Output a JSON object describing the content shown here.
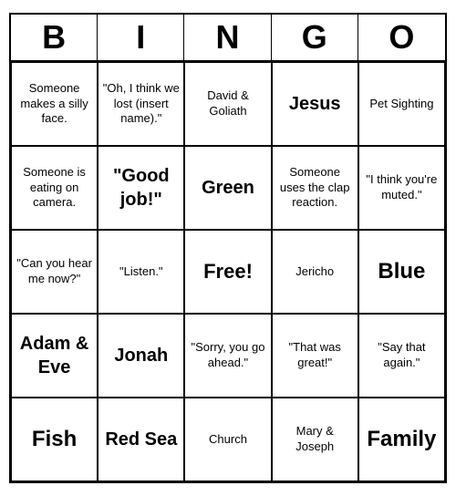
{
  "header": {
    "letters": [
      "B",
      "I",
      "N",
      "G",
      "O"
    ]
  },
  "cells": [
    {
      "text": "Someone makes a silly face.",
      "size": "normal"
    },
    {
      "text": "\"Oh, I think we lost (insert name).\"",
      "size": "normal"
    },
    {
      "text": "David & Goliath",
      "size": "normal"
    },
    {
      "text": "Jesus",
      "size": "large"
    },
    {
      "text": "Pet Sighting",
      "size": "normal"
    },
    {
      "text": "Someone is eating on camera.",
      "size": "normal"
    },
    {
      "text": "\"Good job!\"",
      "size": "large"
    },
    {
      "text": "Green",
      "size": "large"
    },
    {
      "text": "Someone uses the clap reaction.",
      "size": "normal"
    },
    {
      "text": "\"I think you're muted.\"",
      "size": "normal"
    },
    {
      "text": "\"Can you hear me now?\"",
      "size": "normal"
    },
    {
      "text": "\"Listen.\"",
      "size": "normal"
    },
    {
      "text": "Free!",
      "size": "free"
    },
    {
      "text": "Jericho",
      "size": "normal"
    },
    {
      "text": "Blue",
      "size": "xlarge"
    },
    {
      "text": "Adam & Eve",
      "size": "large"
    },
    {
      "text": "Jonah",
      "size": "large"
    },
    {
      "text": "\"Sorry, you go ahead.\"",
      "size": "normal"
    },
    {
      "text": "\"That was great!\"",
      "size": "normal"
    },
    {
      "text": "\"Say that again.\"",
      "size": "normal"
    },
    {
      "text": "Fish",
      "size": "xlarge"
    },
    {
      "text": "Red Sea",
      "size": "large"
    },
    {
      "text": "Church",
      "size": "normal"
    },
    {
      "text": "Mary & Joseph",
      "size": "normal"
    },
    {
      "text": "Family",
      "size": "xlarge"
    }
  ]
}
